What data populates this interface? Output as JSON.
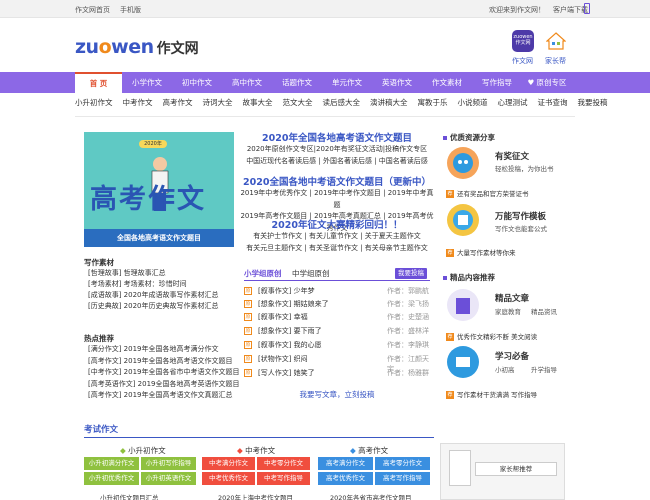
{
  "topbar": {
    "links": [
      "作文网首页",
      "手机版"
    ],
    "right_links": [
      "欢迎来到作文网！",
      "客户端下载"
    ]
  },
  "logo": {
    "en_part1": "zu",
    "en_o": "o",
    "en_part2": "wen",
    "cn": "作文网"
  },
  "header": {
    "app_icon_text1": "zuowen",
    "app_icon_text2": "作文网",
    "app_label": "作文网",
    "home_label": "家长帮"
  },
  "nav": {
    "items": [
      "首 页",
      "小学作文",
      "初中作文",
      "高中作文",
      "话题作文",
      "单元作文",
      "英语作文",
      "作文素材",
      "写作指导",
      "原创专区"
    ]
  },
  "subnav": [
    "小升初作文",
    "中考作文",
    "高考作文",
    "诗词大全",
    "故事大全",
    "范文大全",
    "读后感大全",
    "演讲稿大全",
    "寓教于乐",
    "小说频道",
    "心理测试",
    "证书查询",
    "我要投稿"
  ],
  "banner": {
    "text": "高考作文",
    "caption": "全国各地高考语文作文题目",
    "badge": "2020年"
  },
  "left": {
    "sucai_title": "写作素材",
    "sucai_items": [
      "[哲理故事] 哲理故事汇总",
      "[考场素材] 考场素材：珍惜时间",
      "[成语故事] 2020年成语故事写作素材汇总",
      "[历史典故] 2020年历史典故写作素材汇总"
    ],
    "hot_title": "热点推荐",
    "hot_items": [
      "[满分作文] 2019年全国各地高考满分作文",
      "[高考作文] 2019年全国各地高考语文作文题目",
      "[中考作文] 2019年全国各省市中考语文作文题目",
      "[高考英语作文] 2019全国各地高考英语作文题目",
      "[高考作文] 2019年全国高考语文作文真题汇总"
    ]
  },
  "center": {
    "headline1": "2020年全国各地高考语文作文题目",
    "links1": [
      "2020年原创作文专区|2020年有奖征文活动|投稿作文专区",
      "中国近现代名著读后感 | 外国名著读后感 | 中国名著读后感"
    ],
    "headline2": "2020全国各地中考语文作文题目（更新中）",
    "links2": [
      "2019年中考优秀作文 | 2019年中考作文题目 | 2019年中考真题",
      "2019年高考作文题目 | 2019年高考真题汇总 | 2019年高考优秀作文"
    ],
    "headline3": "2020年征文大赛精彩回归！！",
    "links3": [
      "有关护士节作文 | 有关儿童节作文 | 关于夏天主题作文",
      "有关元旦主题作文 | 有关圣诞节作文 | 有关母亲节主题作文"
    ],
    "tab1": "小学组原创",
    "tab2": "中学组原创",
    "submit": "我要投稿",
    "rows": [
      {
        "icon": "原",
        "title": "[叙事作文] 少年梦",
        "author": "作者：郭鹏航"
      },
      {
        "icon": "原",
        "title": "[想象作文] 期姑娘来了",
        "author": "作者：梁飞扬"
      },
      {
        "icon": "原",
        "title": "[叙事作文] 幸福",
        "author": "作者：史楚涵"
      },
      {
        "icon": "原",
        "title": "[想象作文] 要下雨了",
        "author": "作者：盛林洋"
      },
      {
        "icon": "原",
        "title": "[叙事作文] 我的心愿",
        "author": "作者：李静琪"
      },
      {
        "icon": "原",
        "title": "[状物作文] 织闷",
        "author": "作者：江颜天宇"
      },
      {
        "icon": "原",
        "title": "[写人作文] 她笑了",
        "author": "作者：杨雅群"
      }
    ],
    "more": "我要写文章，立刻投稿"
  },
  "right": {
    "res_title": "优质资源分享",
    "res1_title": "有奖征文",
    "res1_sub": "轻松投稿，为你出书",
    "res1_line": "还有奖品和官方荣誉证书",
    "res2_title": "万能写作模板",
    "res2_sub": "写作文也能套公式",
    "res2_line": "大量写作素材等你来",
    "fine_title": "精品内容推荐",
    "f1_title": "精品文章",
    "f1_subs": [
      "家庭教育",
      "精品资讯"
    ],
    "f1_line": "优秀作文精彩不断 美文阅读",
    "f2_title": "学习必备",
    "f2_subs": [
      "小初高",
      "升学指导"
    ],
    "f2_line": "写作素材干货满满 写作指导"
  },
  "exam": {
    "title": "考试作文",
    "groups": [
      {
        "name": "小升初作文",
        "cells": [
          "小升初满分作文",
          "小升初写作指导",
          "小升初优秀作文",
          "小升初英语作文"
        ],
        "color": "#8fc13f"
      },
      {
        "name": "中考作文",
        "cells": [
          "中考满分作文",
          "中考零分作文",
          "中考优秀作文",
          "中考写作指导"
        ],
        "color": "#f04e3e"
      },
      {
        "name": "高考作文",
        "cells": [
          "高考满分作文",
          "高考零分作文",
          "高考优秀作文",
          "高考写作指导"
        ],
        "color": "#3a8fe0"
      }
    ],
    "promo_label": "家长帮推荐",
    "bottom_left": "小升初作文题目汇总",
    "bottom_mid": "2020年上海中考作文题目",
    "bottom_right": "2020年各省市高考作文题目"
  }
}
